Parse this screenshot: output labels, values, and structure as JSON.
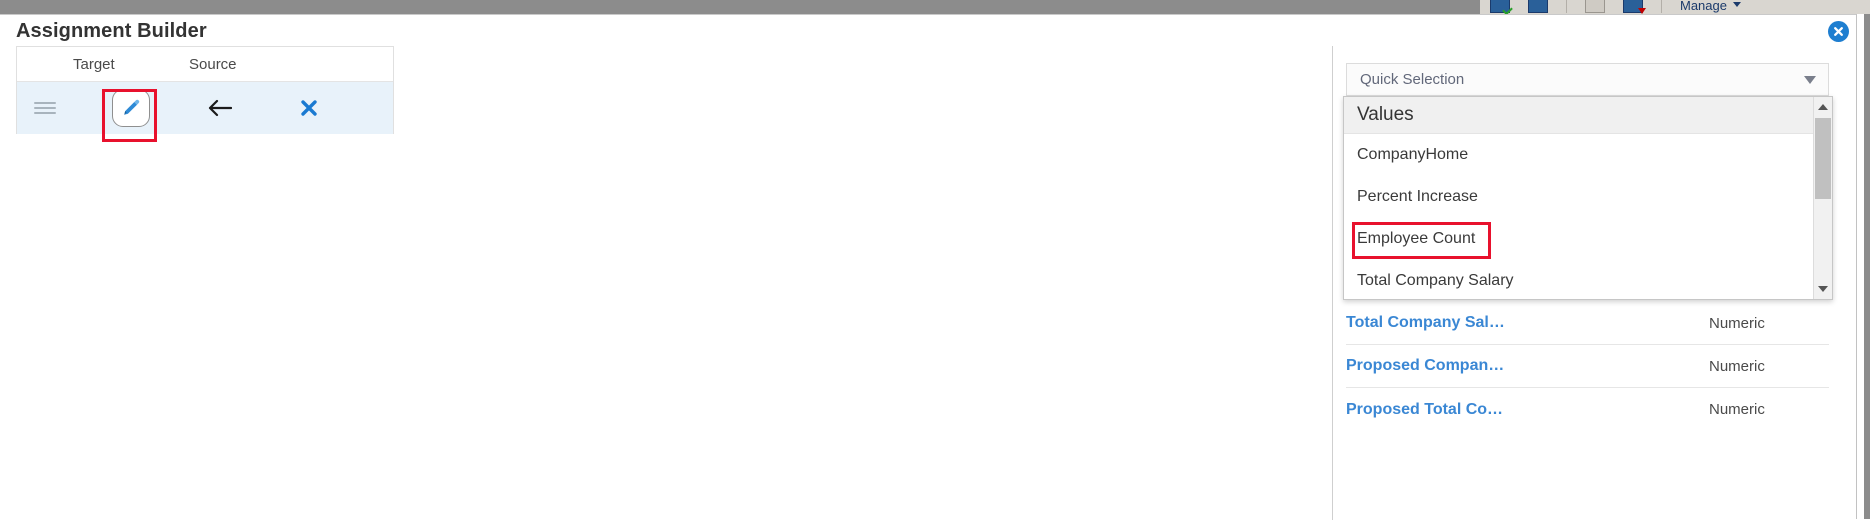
{
  "background_toolbar": {
    "menu_label": "Manage",
    "caret_icon": "chevron-down-icon"
  },
  "dialog": {
    "title": "Assignment Builder",
    "close_icon": "close-icon"
  },
  "mapping_table": {
    "headers": {
      "handle": "",
      "target": "Target",
      "source": "Source"
    },
    "rows": [
      {
        "drag_handle_icon": "drag-handle-icon",
        "edit_icon": "pencil-icon",
        "direction_icon": "arrow-left-icon",
        "remove_icon": "close-x-icon",
        "highlighted": true
      }
    ]
  },
  "quick_selection": {
    "label": "Quick Selection",
    "caret_icon": "chevron-down-icon",
    "expanded": true
  },
  "dropdown": {
    "group_label": "Values",
    "options": [
      {
        "label": "CompanyHome",
        "highlighted": false
      },
      {
        "label": "Percent Increase",
        "highlighted": false
      },
      {
        "label": "Employee Count",
        "highlighted": true
      },
      {
        "label": "Total Company Salary",
        "highlighted": false
      }
    ],
    "scrollbar": {
      "up_icon": "scroll-up-icon",
      "down_icon": "scroll-down-icon"
    }
  },
  "field_list": {
    "rows": [
      {
        "name": "Total Company Sal…",
        "type": "Numeric"
      },
      {
        "name": "Proposed Compan…",
        "type": "Numeric"
      },
      {
        "name": "Proposed Total Co…",
        "type": "Numeric"
      }
    ]
  },
  "colors": {
    "accent_blue": "#3a87d4",
    "close_blue": "#1e7ed0",
    "highlight_red": "#e8112d",
    "row_selected": "#e8f2fa"
  }
}
